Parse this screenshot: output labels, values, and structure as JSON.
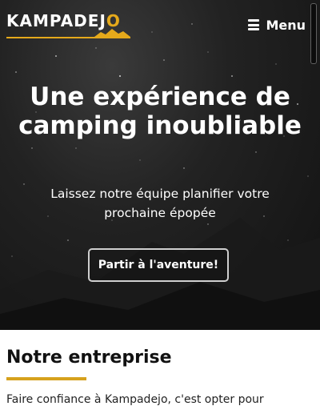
{
  "brand": {
    "logo_main": "KAMPADEJ",
    "logo_accent": "O",
    "accent_color": "#e5a91b"
  },
  "nav": {
    "menu_label": "Menu",
    "menu_icon": "hamburger-icon"
  },
  "hero": {
    "title": "Une expérience de camping inoubliable",
    "subtitle": "Laissez notre équipe planifier votre prochaine épopée",
    "cta_label": "Partir à l'aventure!"
  },
  "company": {
    "title": "Notre entreprise",
    "intro": "Faire confiance à Kampadejo, c'est opter pour"
  }
}
